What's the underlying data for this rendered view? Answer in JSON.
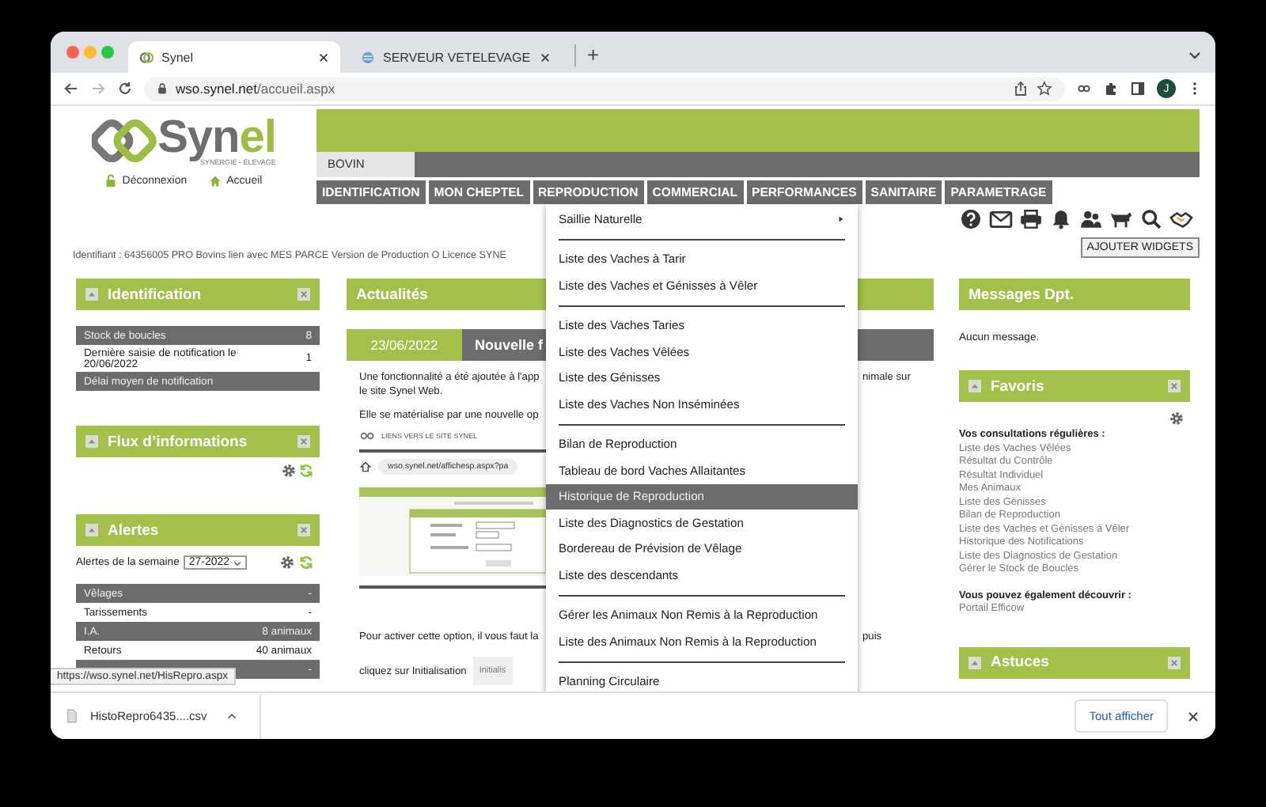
{
  "browser": {
    "tabs": [
      {
        "title": "Synel",
        "selected": true
      },
      {
        "title": "SERVEUR VETELEVAGE",
        "selected": false
      }
    ],
    "new_tab": "+",
    "url_host": "wso.synel.net",
    "url_path": "/accueil.aspx",
    "profile_initial": "J"
  },
  "header": {
    "logo_parts": [
      "Syn",
      "el"
    ],
    "logo_tagline": "SYNERGIE - ÉLEVAGE",
    "links": [
      {
        "label": "Déconnexion",
        "kind": "logout"
      },
      {
        "label": "Accueil",
        "kind": "home"
      }
    ],
    "species_tab": "BOVIN",
    "nav": [
      "IDENTIFICATION",
      "MON CHEPTEL",
      "REPRODUCTION",
      "COMMERCIAL",
      "PERFORMANCES",
      "SANITAIRE",
      "PARAMETRAGE"
    ]
  },
  "toolbar": {
    "identifiant": "Identifiant : 64356005 PRO Bovins lien avec MES PARCE Version de Production O Licence SYNE",
    "add_widgets": "AJOUTER WIDGETS"
  },
  "left_panels": [
    {
      "title": "Identification",
      "controls": true,
      "rows": [
        {
          "label": "Stock de boucles",
          "value": "8",
          "shaded": true
        },
        {
          "label": "Dernière saisie de notification le 20/06/2022",
          "value": "1",
          "shaded": false
        },
        {
          "label": "Délai moyen de notification",
          "shaded": true
        }
      ]
    },
    {
      "title": "Flux d’informations",
      "controls": true,
      "tools": true
    },
    {
      "title": "Alertes",
      "controls": true,
      "tools": true,
      "filter": {
        "label": "Alertes de la semaine",
        "value": "27-2022"
      },
      "rows": [
        {
          "label": "Vêlages",
          "value": "-",
          "shaded": true
        },
        {
          "label": "Tarissements",
          "value": "-",
          "shaded": false
        },
        {
          "label": "I.A.",
          "value": "8 animaux",
          "shaded": true
        },
        {
          "label": "Retours",
          "value": "40 animaux",
          "shaded": false
        },
        {
          "value": "-",
          "shaded": true
        }
      ]
    }
  ],
  "news": {
    "title": "Actualités",
    "date": "23/06/2022",
    "headline": "Nouvelle f",
    "lines": [
      {
        "left": "Une fonctionnalité a été ajoutée à l'app",
        "right": "nimale sur"
      },
      {
        "left": "le site Synel Web."
      },
      {
        "left": "Elle se matérialise par une nouvelle op"
      }
    ],
    "links_caption": "LIENS VERS LE SITE SYNEL",
    "address": "wso.synel.net/affichesp.aspx?pa",
    "footer_lines": [
      {
        "left": "Pour activer cette option, il vous faut la",
        "right": "puis"
      }
    ],
    "last_line": "cliquez sur Initialisation",
    "init_button": "Initialis"
  },
  "right_panels": {
    "messages": {
      "title": "Messages Dpt.",
      "text": "Aucun message."
    },
    "favorites": {
      "title": "Favoris",
      "intro": "Vos consultations régulières :",
      "links": [
        "Liste des Vaches Vêlées",
        "Résultat du Contrôle",
        "Résultat Individuel",
        "Mes Animaux",
        "Liste des Génisses",
        "Bilan de Reproduction",
        "Liste des Vaches et Génisses à Vêler",
        "Historique des Notifications",
        "Liste des Diagnostics de Gestation",
        "Gérer le Stock de Boucles"
      ],
      "discover": "Vous pouvez également découvrir :",
      "portal": "Portail Efficow"
    },
    "tips": {
      "title": "Astuces"
    }
  },
  "reproduction_menu": [
    {
      "kind": "submenu",
      "label": "Saillie Naturelle",
      "selected": false
    },
    {
      "kind": "separator"
    },
    {
      "kind": "item",
      "label": "Liste des Vaches à Tarir",
      "selected": false
    },
    {
      "kind": "item",
      "label": "Liste des Vaches et Génisses à Vêler",
      "selected": false
    },
    {
      "kind": "separator"
    },
    {
      "kind": "item",
      "label": "Liste des Vaches Taries",
      "selected": false
    },
    {
      "kind": "item",
      "label": "Liste des Vaches Vêlées",
      "selected": false
    },
    {
      "kind": "item",
      "label": "Liste des Génisses",
      "selected": false
    },
    {
      "kind": "item",
      "label": "Liste des Vaches Non Inséminées",
      "selected": false
    },
    {
      "kind": "separator"
    },
    {
      "kind": "item",
      "label": "Bilan de Reproduction",
      "selected": false
    },
    {
      "kind": "item",
      "label": "Tableau de bord Vaches Allaitantes",
      "selected": false
    },
    {
      "kind": "item",
      "label": "Historique de Reproduction",
      "selected": true
    },
    {
      "kind": "item",
      "label": "Liste des Diagnostics de Gestation",
      "selected": false
    },
    {
      "kind": "item",
      "label": "Bordereau de Prévision de Vêlage",
      "selected": false
    },
    {
      "kind": "item",
      "label": "Liste des descendants",
      "selected": false
    },
    {
      "kind": "separator"
    },
    {
      "kind": "item",
      "label": "Gérer les Animaux Non Remis à la Reproduction",
      "selected": false
    },
    {
      "kind": "item",
      "label": "Liste des Animaux Non Remis à la Reproduction",
      "selected": false
    },
    {
      "kind": "separator"
    },
    {
      "kind": "item",
      "label": "Planning Circulaire",
      "selected": false
    }
  ],
  "status_url": "https://wso.synel.net/HisRepro.aspx",
  "download": {
    "filename": "HistoRepro6435....csv",
    "show_all": "Tout afficher"
  }
}
